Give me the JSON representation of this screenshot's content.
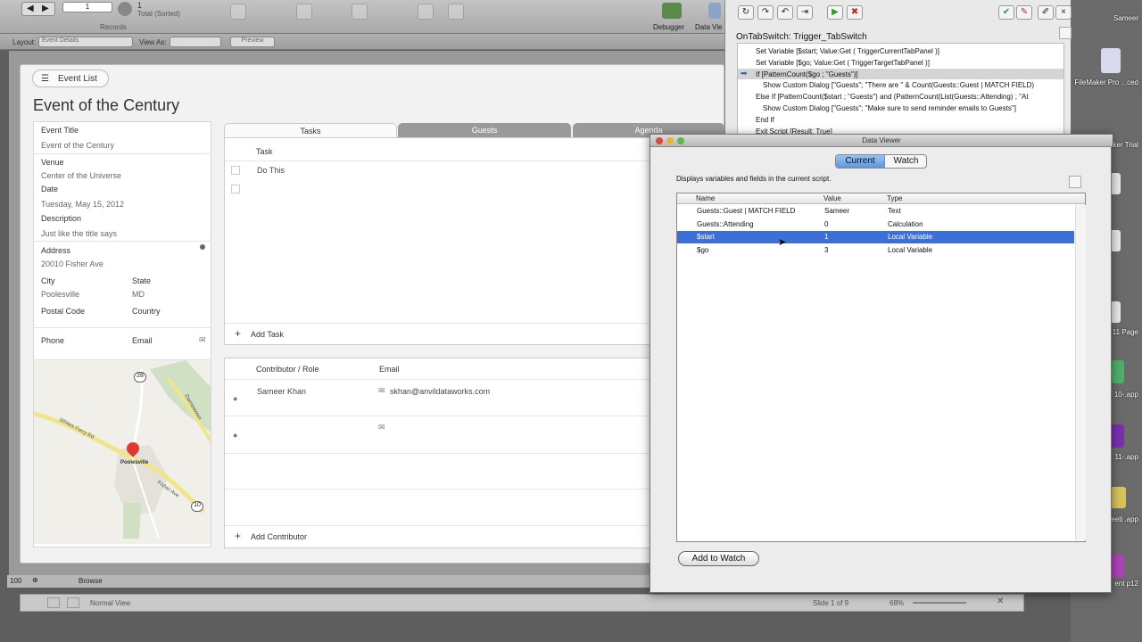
{
  "toolbar": {
    "record_number": "1",
    "record_total": "1",
    "total_label": "Total (Sorted)",
    "records_label": "Records",
    "debugger_label": "Debugger",
    "dataviewer_label": "Data Vie"
  },
  "layoutbar": {
    "layout_label": "Layout:",
    "layout_value": "Event Details",
    "viewas_label": "View As:",
    "preview_label": "Preview"
  },
  "layout": {
    "event_list_button": "Event List",
    "title": "Event of the Century",
    "fields": {
      "event_title_label": "Event Title",
      "event_title_value": "Event of the Century",
      "venue_label": "Venue",
      "venue_value": "Center of the Universe",
      "date_label": "Date",
      "date_value": "Tuesday, May 15, 2012",
      "description_label": "Description",
      "description_value": "Just like the title says",
      "address_label": "Address",
      "address_value": "20010 Fisher Ave",
      "city_label": "City",
      "city_value": "Poolesville",
      "state_label": "State",
      "state_value": "MD",
      "postal_label": "Postal Code",
      "country_label": "Country",
      "phone_label": "Phone",
      "email_label": "Email"
    },
    "map": {
      "town": "Poolesville",
      "road1": "Whites Ferry Rd",
      "road2": "Fisher Ave",
      "road3": "Darnestown",
      "route1": "28",
      "route2": "10"
    },
    "tabs": [
      "Tasks",
      "Guests",
      "Agenda"
    ],
    "tasks": {
      "header": "Task",
      "rows": [
        "Do This",
        ""
      ],
      "add_label": "Add Task"
    },
    "contributors": {
      "header_name": "Contributor / Role",
      "header_email": "Email",
      "rows": [
        {
          "name": "Sameer Khan",
          "email": "skhan@anvildataworks.com"
        },
        {
          "name": "",
          "email": ""
        }
      ],
      "add_label": "Add Contributor"
    }
  },
  "statusbar": {
    "zoom": "100",
    "mode": "Browse"
  },
  "bottombar": {
    "view": "Normal View",
    "slide": "Slide 1 of 9",
    "zoom": "68%"
  },
  "debugger": {
    "script_name": "OnTabSwitch: Trigger_TabSwitch",
    "lines": [
      "Set Variable [$start; Value:Get ( TriggerCurrentTabPanel )]",
      "Set Variable [$go; Value:Get ( TriggerTargetTabPanel )]",
      "If [PatternCount($go ; \"Guests\")]",
      "  Show Custom Dialog [\"Guests\"; \"There are \" & Count(Guests::Guest | MATCH FIELD)",
      "Else If [PatternCount($start ; \"Guests\") and (PatternCount(List(Guests::Attending) ; \"At",
      "  Show Custom Dialog [\"Guests\"; \"Make sure to send reminder emails to Guests\"]",
      "End If",
      "Exit Script [Result: True]"
    ],
    "current_line": 2
  },
  "dataviewer": {
    "title": "Data Viewer",
    "tab_current": "Current",
    "tab_watch": "Watch",
    "description": "Displays variables and fields in the current script.",
    "columns": [
      "Name",
      "Value",
      "Type"
    ],
    "rows": [
      {
        "name": "Guests::Guest | MATCH FIELD",
        "value": "Sameer",
        "type": "Text"
      },
      {
        "name": "Guests::Attending",
        "value": "0",
        "type": "Calculation"
      },
      {
        "name": "$start",
        "value": "1",
        "type": "Local Variable"
      },
      {
        "name": "$go",
        "value": "3",
        "type": "Local Variable"
      }
    ],
    "selected_row": 2,
    "add_watch": "Add to Watch"
  },
  "desktop": {
    "items": [
      "Sameer",
      "FileMaker Pro ...ced",
      "maker Trial",
      "11 Page",
      "10-.app",
      "11-.app",
      "Meeti .app",
      "ent p12"
    ]
  },
  "colors": {
    "selection": "#3d6fd8",
    "segment_active": "#6fa4e6",
    "pin": "#e03a2f"
  }
}
